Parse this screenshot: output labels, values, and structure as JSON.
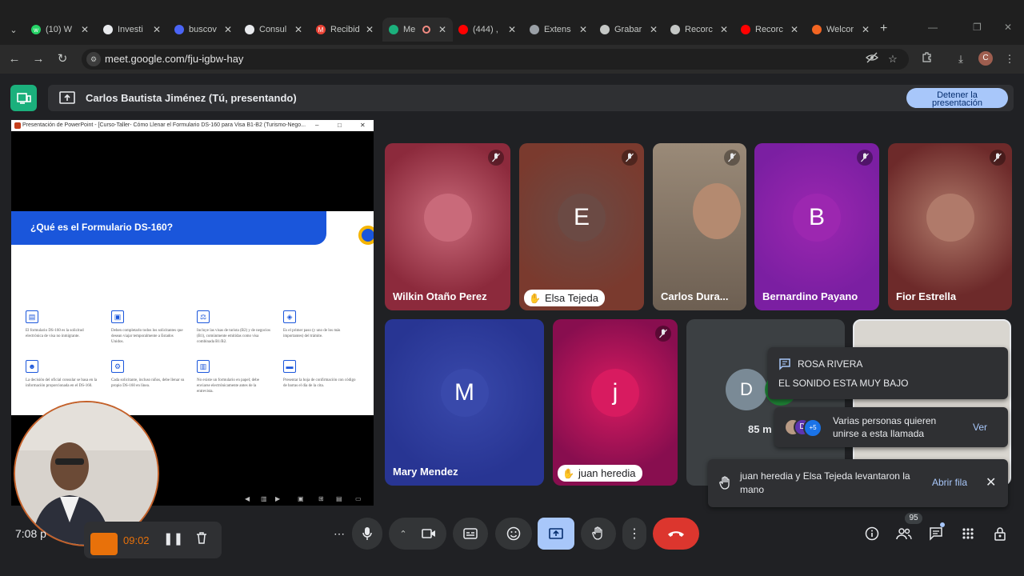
{
  "browser": {
    "tabs": [
      {
        "title": "(10) W",
        "color": "#25d366",
        "glyph": "w"
      },
      {
        "title": "Investi",
        "color": "#e8eaed",
        "glyph": ""
      },
      {
        "title": "buscov",
        "color": "#4a64f5",
        "glyph": ""
      },
      {
        "title": "Consul",
        "color": "#e8eaed",
        "glyph": ""
      },
      {
        "title": "Recibid",
        "color": "#ea4335",
        "glyph": "M"
      },
      {
        "title": "Me",
        "color": "#1bb07c",
        "glyph": ""
      },
      {
        "title": "(444) ,",
        "color": "#ff0000",
        "glyph": ""
      },
      {
        "title": "Extens",
        "color": "#9aa0a6",
        "glyph": ""
      },
      {
        "title": "Grabar",
        "color": "#c4c7c5",
        "glyph": ""
      },
      {
        "title": "Recorc",
        "color": "#c4c7c5",
        "glyph": ""
      },
      {
        "title": "Recorc",
        "color": "#ff0000",
        "glyph": ""
      },
      {
        "title": "Welcor",
        "color": "#f26522",
        "glyph": ""
      }
    ],
    "url": "meet.google.com/fju-igbw-hay",
    "profile_initial": "C"
  },
  "meet": {
    "presenting_label": "Carlos Bautista Jiménez (Tú, presentando)",
    "stop_presenting_line1": "Detener la",
    "stop_presenting_line2": "presentación",
    "ppt_window_title": "Presentación de PowerPoint - [Curso-Taller- Cómo Llenar el Formulario DS-160 para Visa B1-B2 (Turismo-Nego...",
    "slide": {
      "title": "¿Qué es el Formulario DS-160?",
      "cells": [
        "El formulario DS-160 es la solicitud electrónica de visa no inmigrante.",
        "Deben completarlo todos los solicitantes que desean viajar temporalmente a Estados Unidos.",
        "Incluye las visas de turista (B2) y de negocios (B1), comúnmente emitidas como visa combinada B1/B2.",
        "Es el primer paso (y uno de los más importantes) del trámite.",
        "La decisión del oficial consular se basa en la información proporcionada en el DS-160.",
        "Cada solicitante, incluso niños, debe llenar su propio DS-160 en línea.",
        "No existe un formulario en papel; debe enviarse electrónicamente antes de la entrevista.",
        "Presentar la hoja de confirmación con código de barras el día de la cita."
      ]
    },
    "clock": "7:08 p",
    "recording_time": "09:02",
    "participants": [
      {
        "name": "Wilkin Otaño Perez",
        "initial": "",
        "bg": "#8c2a3c",
        "avatar": "#c96a7a",
        "muted": true,
        "hand": false
      },
      {
        "name": "Elsa Tejeda",
        "initial": "E",
        "bg": "#7a3a2e",
        "avatar": "#6b4a44",
        "muted": true,
        "hand": true
      },
      {
        "name": "Carlos Dura...",
        "initial": "",
        "bg": "#7d6f62",
        "avatar": "#b89a84",
        "muted": true,
        "hand": false
      },
      {
        "name": "Bernardino Payano",
        "initial": "B",
        "bg": "#7b1fa2",
        "avatar": "#9c27b0",
        "muted": true,
        "hand": false
      },
      {
        "name": "Fior Estrella",
        "initial": "",
        "bg": "#6d2a2a",
        "avatar": "#b07a6a",
        "muted": true,
        "hand": false
      },
      {
        "name": "Mary Mendez",
        "initial": "M",
        "bg": "#283593",
        "avatar": "#3949ab",
        "muted": false,
        "hand": false
      },
      {
        "name": "juan heredia",
        "initial": "j",
        "bg": "#880e4f",
        "avatar": "#d81b60",
        "muted": true,
        "hand": true
      }
    ],
    "overflow_tile": {
      "initial": "D",
      "count_label": "85 m"
    },
    "chat_toast": {
      "from": "ROSA RIVERA",
      "message": "EL SONIDO ESTA MUY BAJO"
    },
    "join_toast": {
      "text": "Varias personas quieren unirse a esta llamada",
      "more": "+5",
      "action": "Ver",
      "initial": "D"
    },
    "hand_toast": {
      "text": "juan heredia y Elsa Tejeda levantaron la mano",
      "action": "Abrir fila"
    },
    "people_count": "95"
  }
}
